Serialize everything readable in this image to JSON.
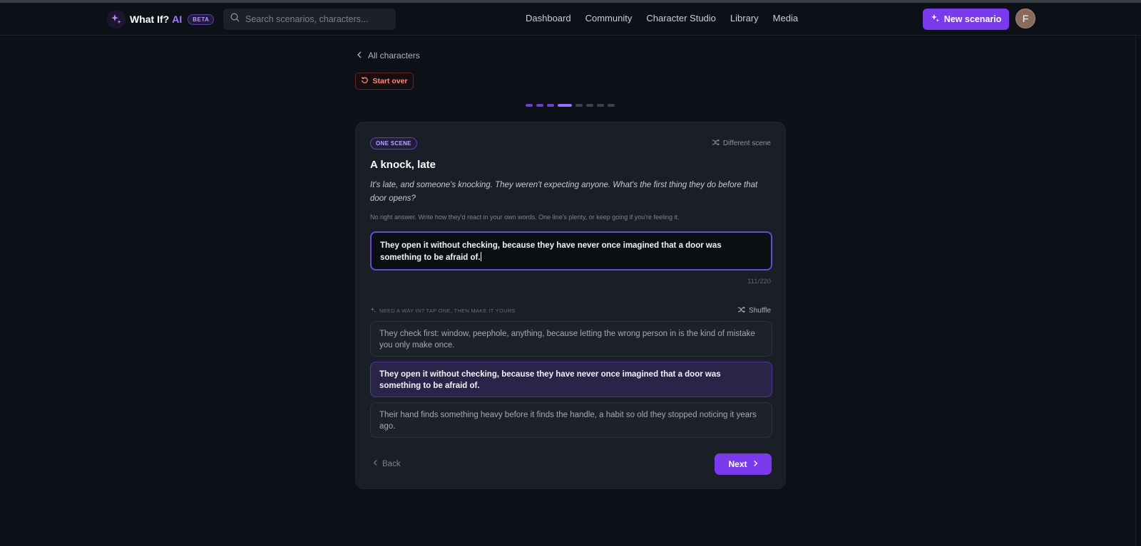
{
  "header": {
    "app_name": "What If?",
    "app_name_suffix": "AI",
    "beta_label": "BETA",
    "search_placeholder": "Search scenarios, characters...",
    "nav": [
      "Dashboard",
      "Community",
      "Character Studio",
      "Library",
      "Media"
    ],
    "new_scenario_label": "New scenario",
    "avatar_initial": "F"
  },
  "page": {
    "back_label": "All characters",
    "start_over_label": "Start over",
    "steps_total": 8,
    "current_step": 4
  },
  "card": {
    "tag": "ONE SCENE",
    "different_scene_label": "Different scene",
    "title": "A knock, late",
    "prompt": "It's late, and someone's knocking. They weren't expecting anyone. What's the first thing they do before that door opens?",
    "hint": "No right answer. Write how they'd react in your own words. One line's plenty, or keep going if you're feeling it.",
    "answer": "They open it without checking, because they have never once imagined that a door was something to be afraid of.",
    "char_count": "111/220",
    "ideas_label": "NEED A WAY IN? TAP ONE, THEN MAKE IT YOURS",
    "shuffle_label": "Shuffle",
    "options": [
      "They check first: window, peephole, anything, because letting the wrong person in is the kind of mistake you only make once.",
      "They open it without checking, because they have never once imagined that a door was something to be afraid of.",
      "Their hand finds something heavy before it finds the handle, a habit so old they stopped noticing it years ago."
    ],
    "selected_option": 1,
    "back_label": "Back",
    "next_label": "Next"
  },
  "colors": {
    "accent": "#7c3aed",
    "background": "#0c1118",
    "card": "#1a1f27",
    "start_over": "#ff8a7a"
  }
}
